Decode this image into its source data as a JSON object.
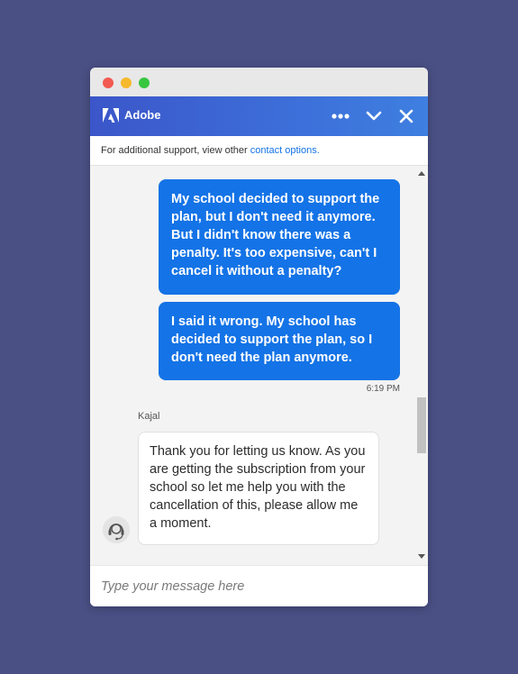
{
  "window": {
    "controls": [
      "close",
      "minimize",
      "zoom"
    ]
  },
  "header": {
    "brand": "Adobe",
    "logo_icon": "adobe-logo-icon",
    "actions": [
      "more-options-icon",
      "chevron-down-icon",
      "close-icon"
    ],
    "accent_color": "#3d6fd9"
  },
  "support_bar": {
    "text": "For additional support, view other ",
    "link": "contact options."
  },
  "messages": {
    "user": [
      "My school decided to support the plan, but I don't need it anymore. But I didn't know there was a penalty. It's too expensive, can't I cancel it without a penalty?",
      "I said it wrong. My school has decided to support the plan, so I don't need the plan anymore."
    ],
    "user_timestamp": "6:19 PM",
    "user_bubble_color": "#1473e6",
    "agent_name": "Kajal",
    "agent": "Thank you for letting us know. As you are getting the subscription from your school so let me help you with the cancellation of this, please allow me a moment.",
    "agent_avatar_icon": "agent-headset-icon"
  },
  "composer": {
    "placeholder": "Type your message here",
    "value": ""
  }
}
